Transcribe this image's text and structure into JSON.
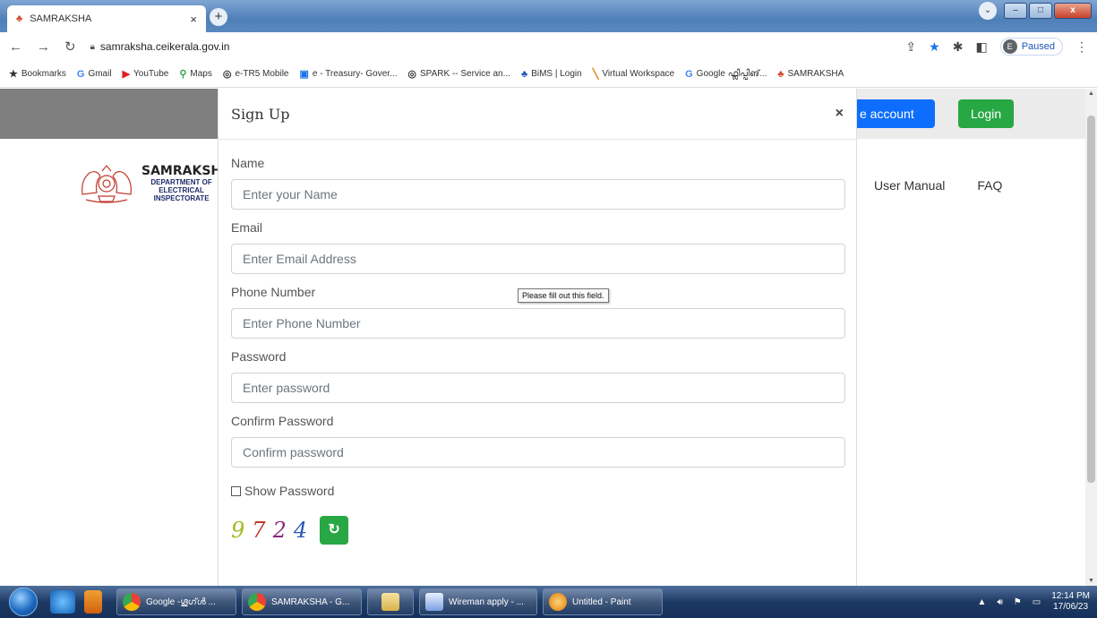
{
  "browser": {
    "tab_title": "SAMRAKSHA",
    "url": "samraksha.ceikerala.gov.in",
    "profile_initial": "E",
    "profile_status": "Paused",
    "bookmarks": [
      {
        "icon": "★",
        "label": "Bookmarks"
      },
      {
        "icon": "G",
        "label": "Gmail"
      },
      {
        "icon": "▶",
        "label": "YouTube"
      },
      {
        "icon": "⚲",
        "label": "Maps"
      },
      {
        "icon": "◎",
        "label": "e-TR5 Mobile"
      },
      {
        "icon": "▣",
        "label": "e - Treasury- Gover..."
      },
      {
        "icon": "◎",
        "label": "SPARK -- Service an..."
      },
      {
        "icon": "♣",
        "label": "BiMS | Login"
      },
      {
        "icon": "╲",
        "label": "Virtual Workspace"
      },
      {
        "icon": "G",
        "label": "Google ഫ്ലിപ്പിങ്..."
      },
      {
        "icon": "♣",
        "label": "SAMRAKSHA"
      }
    ]
  },
  "page": {
    "create_account_label": "e account",
    "login_label": "Login",
    "logo_title": "SAMRAKSH",
    "logo_sub1": "DEPARTMENT OF",
    "logo_sub2": "ELECTRICAL",
    "logo_sub3": "INSPECTORATE",
    "nav": {
      "user_manual": "User Manual",
      "faq": "FAQ"
    }
  },
  "modal": {
    "title": "Sign Up",
    "close": "×",
    "fields": {
      "name": {
        "label": "Name",
        "placeholder": "Enter your Name"
      },
      "email": {
        "label": "Email",
        "placeholder": "Enter Email Address"
      },
      "phone": {
        "label": "Phone Number",
        "placeholder": "Enter Phone Number"
      },
      "password": {
        "label": "Password",
        "placeholder": "Enter password"
      },
      "confirm": {
        "label": "Confirm Password",
        "placeholder": "Confirm password"
      }
    },
    "show_password_label": "Show Password",
    "captcha": {
      "c1": "9",
      "c2": "7",
      "c3": "2",
      "c4": "4"
    },
    "refresh_icon": "↻",
    "tooltip": "Please fill out this field."
  },
  "taskbar": {
    "items": [
      {
        "label": "Google -ഗൂഗ്ൾ ..."
      },
      {
        "label": "SAMRAKSHA - G..."
      },
      {
        "label": ""
      },
      {
        "label": "Wireman apply - ..."
      },
      {
        "label": "Untitled - Paint"
      }
    ],
    "time": "12:14 PM",
    "date": "17/06/23"
  }
}
